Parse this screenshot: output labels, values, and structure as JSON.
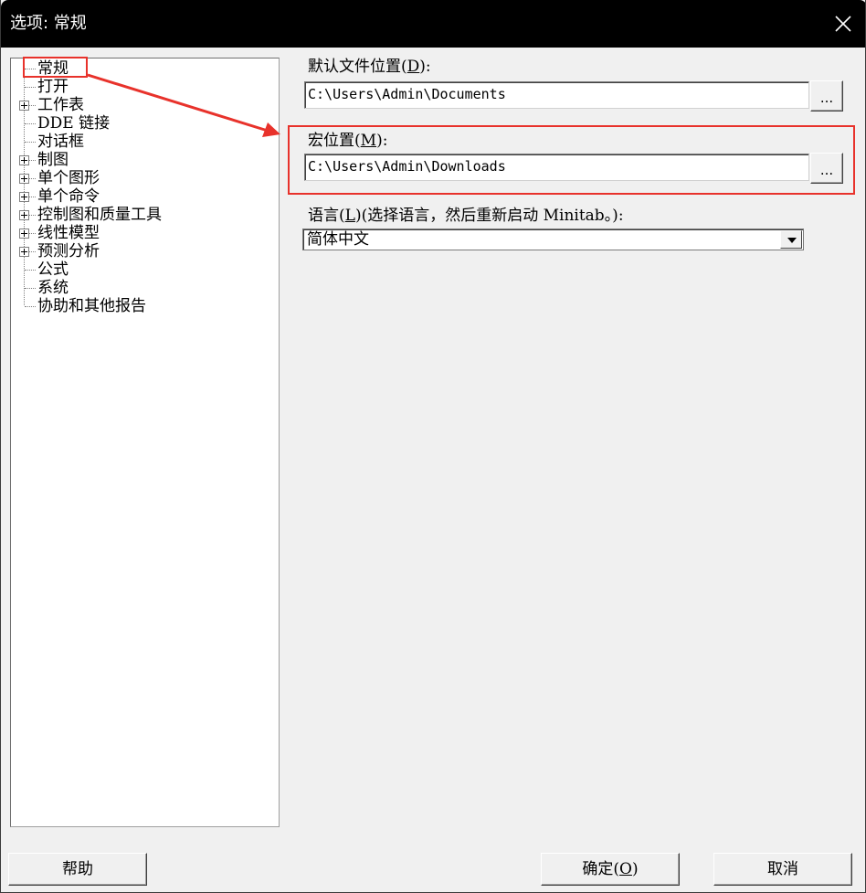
{
  "window": {
    "title": "选项: 常规"
  },
  "tree": {
    "items": [
      {
        "label": "常规",
        "expandable": false
      },
      {
        "label": "打开",
        "expandable": false
      },
      {
        "label": "工作表",
        "expandable": true
      },
      {
        "label": "DDE 链接",
        "expandable": false
      },
      {
        "label": "对话框",
        "expandable": false
      },
      {
        "label": "制图",
        "expandable": true
      },
      {
        "label": "单个图形",
        "expandable": true
      },
      {
        "label": "单个命令",
        "expandable": true
      },
      {
        "label": "控制图和质量工具",
        "expandable": true
      },
      {
        "label": "线性模型",
        "expandable": true
      },
      {
        "label": "预测分析",
        "expandable": true
      },
      {
        "label": "公式",
        "expandable": false
      },
      {
        "label": "系统",
        "expandable": false
      },
      {
        "label": "协助和其他报告",
        "expandable": false
      }
    ],
    "selected": "常规"
  },
  "settings": {
    "default_location": {
      "label_prefix": "默认文件位置(",
      "mnemonic": "D",
      "label_suffix": "):",
      "value": "C:\\Users\\Admin\\Documents",
      "browse_label": "..."
    },
    "macro_location": {
      "label_prefix": "宏位置(",
      "mnemonic": "M",
      "label_suffix": "):",
      "value": "C:\\Users\\Admin\\Downloads",
      "browse_label": "..."
    },
    "language": {
      "label_prefix": "语言(",
      "mnemonic": "L",
      "label_suffix": ")(选择语言，然后重新启动 Minitab。):",
      "value": "简体中文"
    }
  },
  "buttons": {
    "help": "帮助",
    "ok_prefix": "确定(",
    "ok_mnemonic": "O",
    "ok_suffix": ")",
    "cancel": "取消"
  },
  "colors": {
    "annotation": "#e8322b",
    "titlebar": "#000000",
    "dialog_bg": "#f0f0f0"
  }
}
